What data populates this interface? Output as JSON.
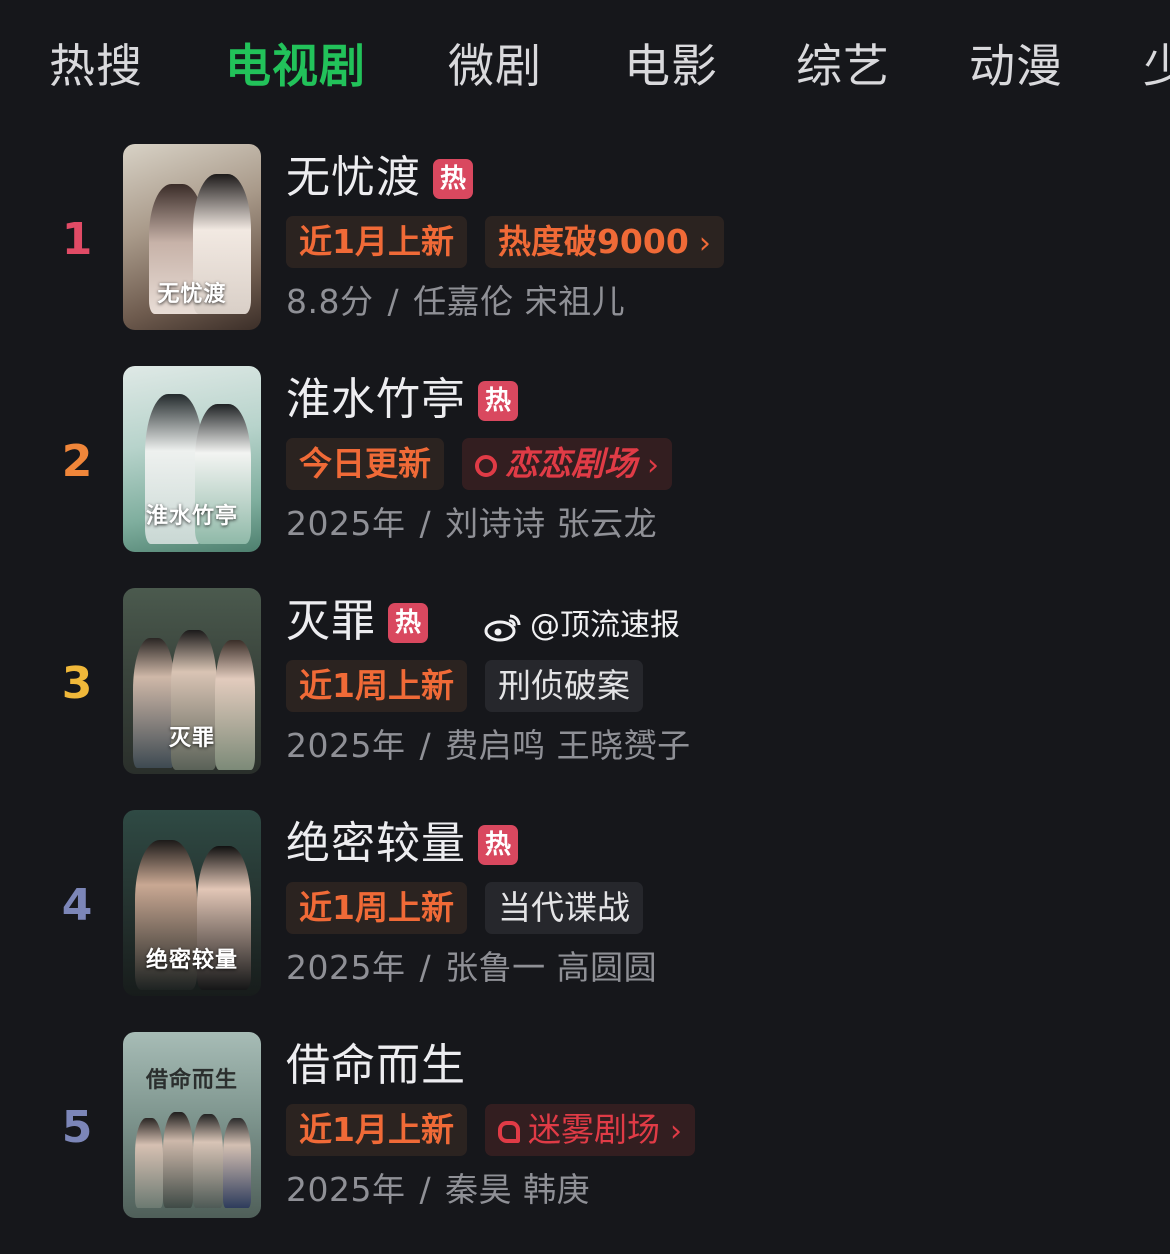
{
  "tabs": [
    "热搜",
    "电视剧",
    "微剧",
    "电影",
    "综艺",
    "动漫",
    "少"
  ],
  "active_tab": "电视剧",
  "hot_label": "热",
  "watermark": "@顶流速报",
  "colors": {
    "active_tab": "#22c25a",
    "hot_badge": "#d9485f",
    "tag_text_orange": "#f06a37",
    "rank_1": "#e14b66",
    "rank_2": "#f0863a",
    "rank_3": "#f0b83a",
    "rank_4": "#7c86b8",
    "rank_5": "#7c86b8"
  },
  "items": [
    {
      "rank": "1",
      "title": "无忧渡",
      "hot": true,
      "tags": [
        {
          "text": "近1月上新",
          "style": "orange"
        },
        {
          "text": "热度破9000",
          "style": "orange",
          "chevron": "›"
        }
      ],
      "meta_left": "8.8分",
      "meta_right": "任嘉伦 宋祖儿",
      "poster_title": "无忧渡"
    },
    {
      "rank": "2",
      "title": "淮水竹亭",
      "hot": true,
      "tags": [
        {
          "text": "今日更新",
          "style": "orange"
        },
        {
          "text": "恋恋剧场",
          "style": "red",
          "chevron": "›",
          "logo": "heart-logo-icon"
        }
      ],
      "meta_left": "2025年",
      "meta_right": "刘诗诗 张云龙",
      "poster_title": "淮水竹亭"
    },
    {
      "rank": "3",
      "title": "灭罪",
      "hot": true,
      "tags": [
        {
          "text": "近1周上新",
          "style": "orange"
        },
        {
          "text": "刑侦破案",
          "style": "gray"
        }
      ],
      "meta_left": "2025年",
      "meta_right": "费启鸣 王晓赟子",
      "poster_title": "灭罪"
    },
    {
      "rank": "4",
      "title": "绝密较量",
      "hot": true,
      "tags": [
        {
          "text": "近1周上新",
          "style": "orange"
        },
        {
          "text": "当代谍战",
          "style": "gray"
        }
      ],
      "meta_left": "2025年",
      "meta_right": "张鲁一 高圆圆",
      "poster_title": "绝密较量"
    },
    {
      "rank": "5",
      "title": "借命而生",
      "hot": false,
      "tags": [
        {
          "text": "近1月上新",
          "style": "orange"
        },
        {
          "text": "迷雾剧场",
          "style": "red",
          "chevron": "›",
          "logo": "mist-logo-icon"
        }
      ],
      "meta_left": "2025年",
      "meta_right": "秦昊 韩庚",
      "poster_title": "借命而生"
    }
  ]
}
